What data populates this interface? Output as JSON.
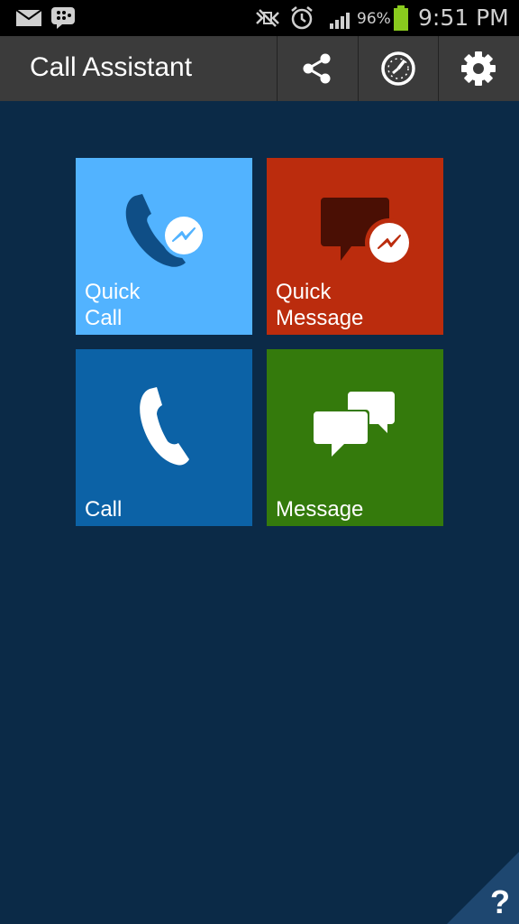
{
  "status_bar": {
    "battery_percent": "96%",
    "time": "9:51 PM",
    "icons": [
      "email-icon",
      "bbm-icon",
      "mute-icon",
      "alarm-icon",
      "signal-icon",
      "battery-icon"
    ]
  },
  "action_bar": {
    "title": "Call Assistant",
    "buttons": [
      {
        "icon": "share-icon"
      },
      {
        "icon": "history-clock-icon"
      },
      {
        "icon": "settings-gear-icon"
      }
    ]
  },
  "tiles": [
    {
      "label": "Quick\nCall",
      "color": "#52b3ff",
      "icon": "phone-messenger-icon"
    },
    {
      "label": "Quick\nMessage",
      "color": "#bb2c0d",
      "icon": "message-messenger-icon"
    },
    {
      "label": "Call",
      "color": "#0c62a6",
      "icon": "phone-icon"
    },
    {
      "label": "Message",
      "color": "#347a0c",
      "icon": "chat-bubbles-icon"
    }
  ],
  "help": {
    "label": "?"
  }
}
